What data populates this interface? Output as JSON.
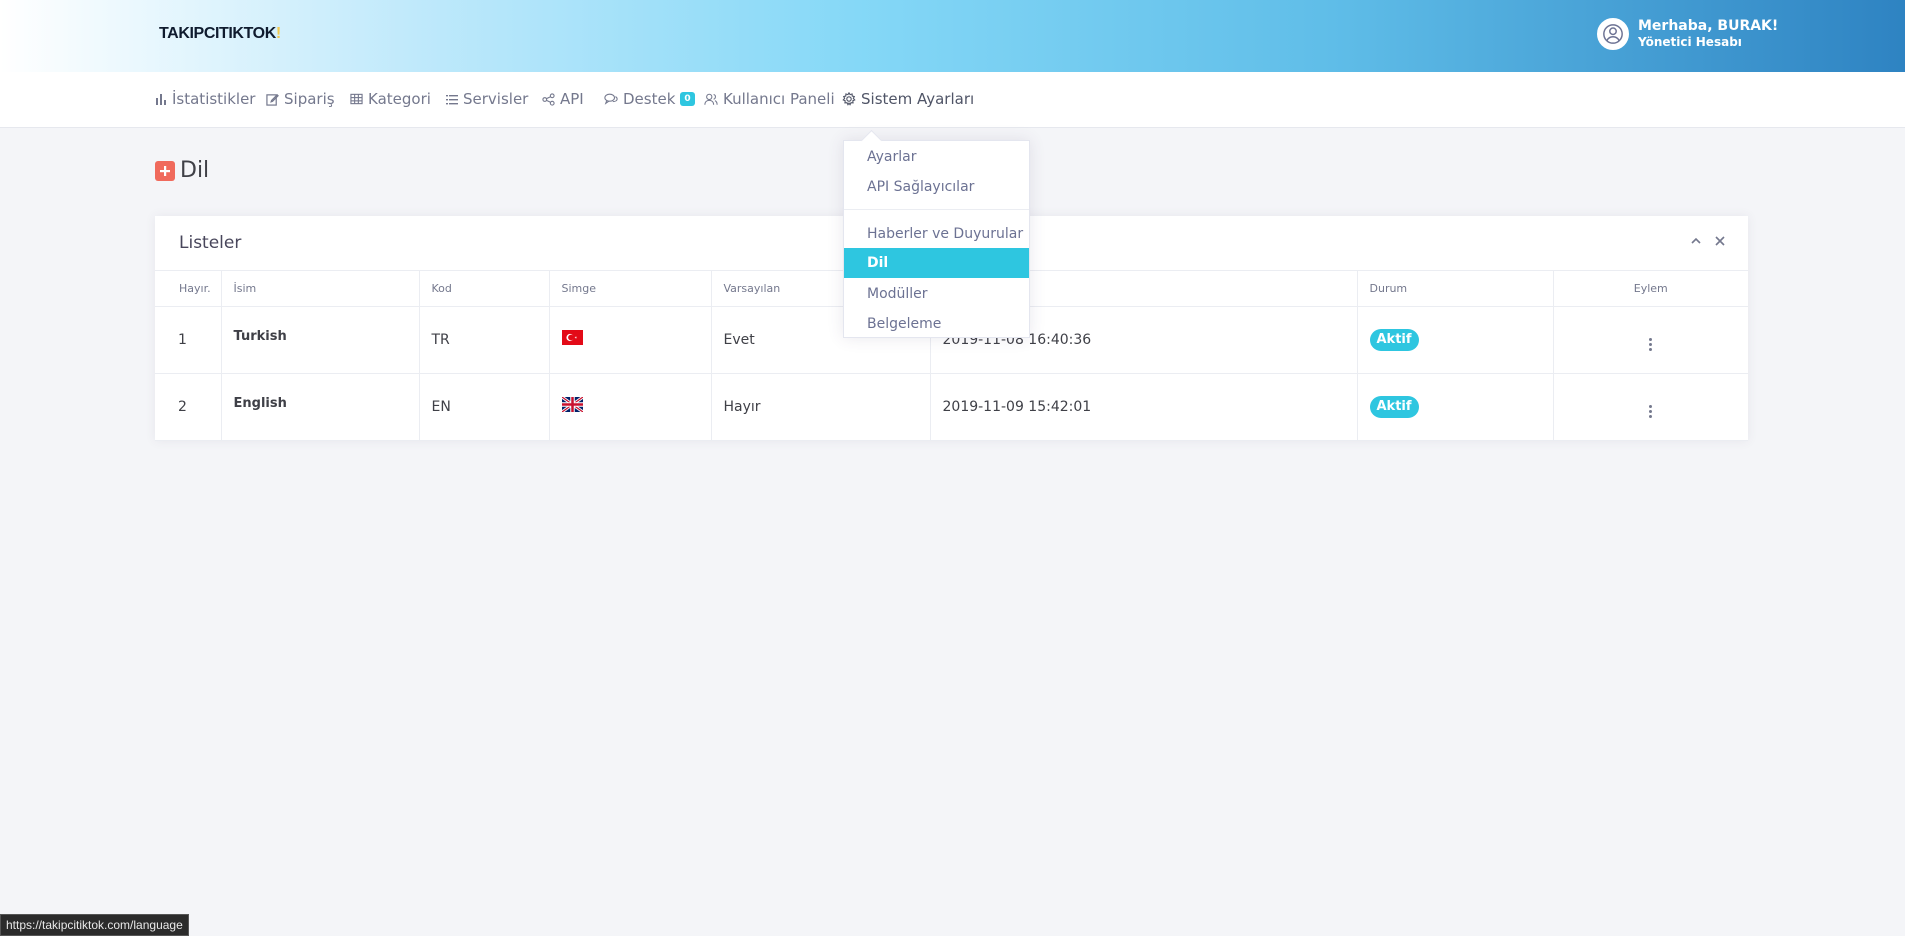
{
  "header": {
    "logo_text": "TAKIPCITIKTOK",
    "user_greeting": "Merhaba, BURAK!",
    "user_role": "Yönetici Hesabı"
  },
  "nav": {
    "items": [
      {
        "label": "İstatistikler",
        "icon": "bar-chart-icon"
      },
      {
        "label": "Sipariş",
        "icon": "edit-icon"
      },
      {
        "label": "Kategori",
        "icon": "table-icon"
      },
      {
        "label": "Servisler",
        "icon": "list-icon"
      },
      {
        "label": "API",
        "icon": "share-icon"
      },
      {
        "label": "Destek",
        "icon": "chat-icon",
        "badge": "0"
      },
      {
        "label": "Kullanıcı Paneli",
        "icon": "users-icon"
      },
      {
        "label": "Sistem Ayarları",
        "icon": "gear-icon"
      }
    ]
  },
  "page": {
    "title": "Dil"
  },
  "card": {
    "title": "Listeler",
    "columns": [
      "Hayır.",
      "İsim",
      "Kod",
      "Simge",
      "Varsayılan",
      "",
      "Durum",
      "Eylem"
    ],
    "rows": [
      {
        "no": "1",
        "name": "Turkish",
        "code": "TR",
        "flag": "tr-flag",
        "default": "Evet",
        "date": "2019-11-08 16:40:36",
        "status": "Aktif"
      },
      {
        "no": "2",
        "name": "English",
        "code": "EN",
        "flag": "uk-flag",
        "default": "Hayır",
        "date": "2019-11-09 15:42:01",
        "status": "Aktif"
      }
    ]
  },
  "dropdown": {
    "items": [
      "Ayarlar",
      "API Sağlayıcılar",
      "Haberler ve Duyurular",
      "Dil",
      "Modüller",
      "Belgeleme"
    ],
    "active": "Dil"
  },
  "statusbar": {
    "url": "https://takipcitiktok.com/language"
  },
  "colors": {
    "accent": "#2ec6e0",
    "title_icon": "#f06a5c"
  }
}
